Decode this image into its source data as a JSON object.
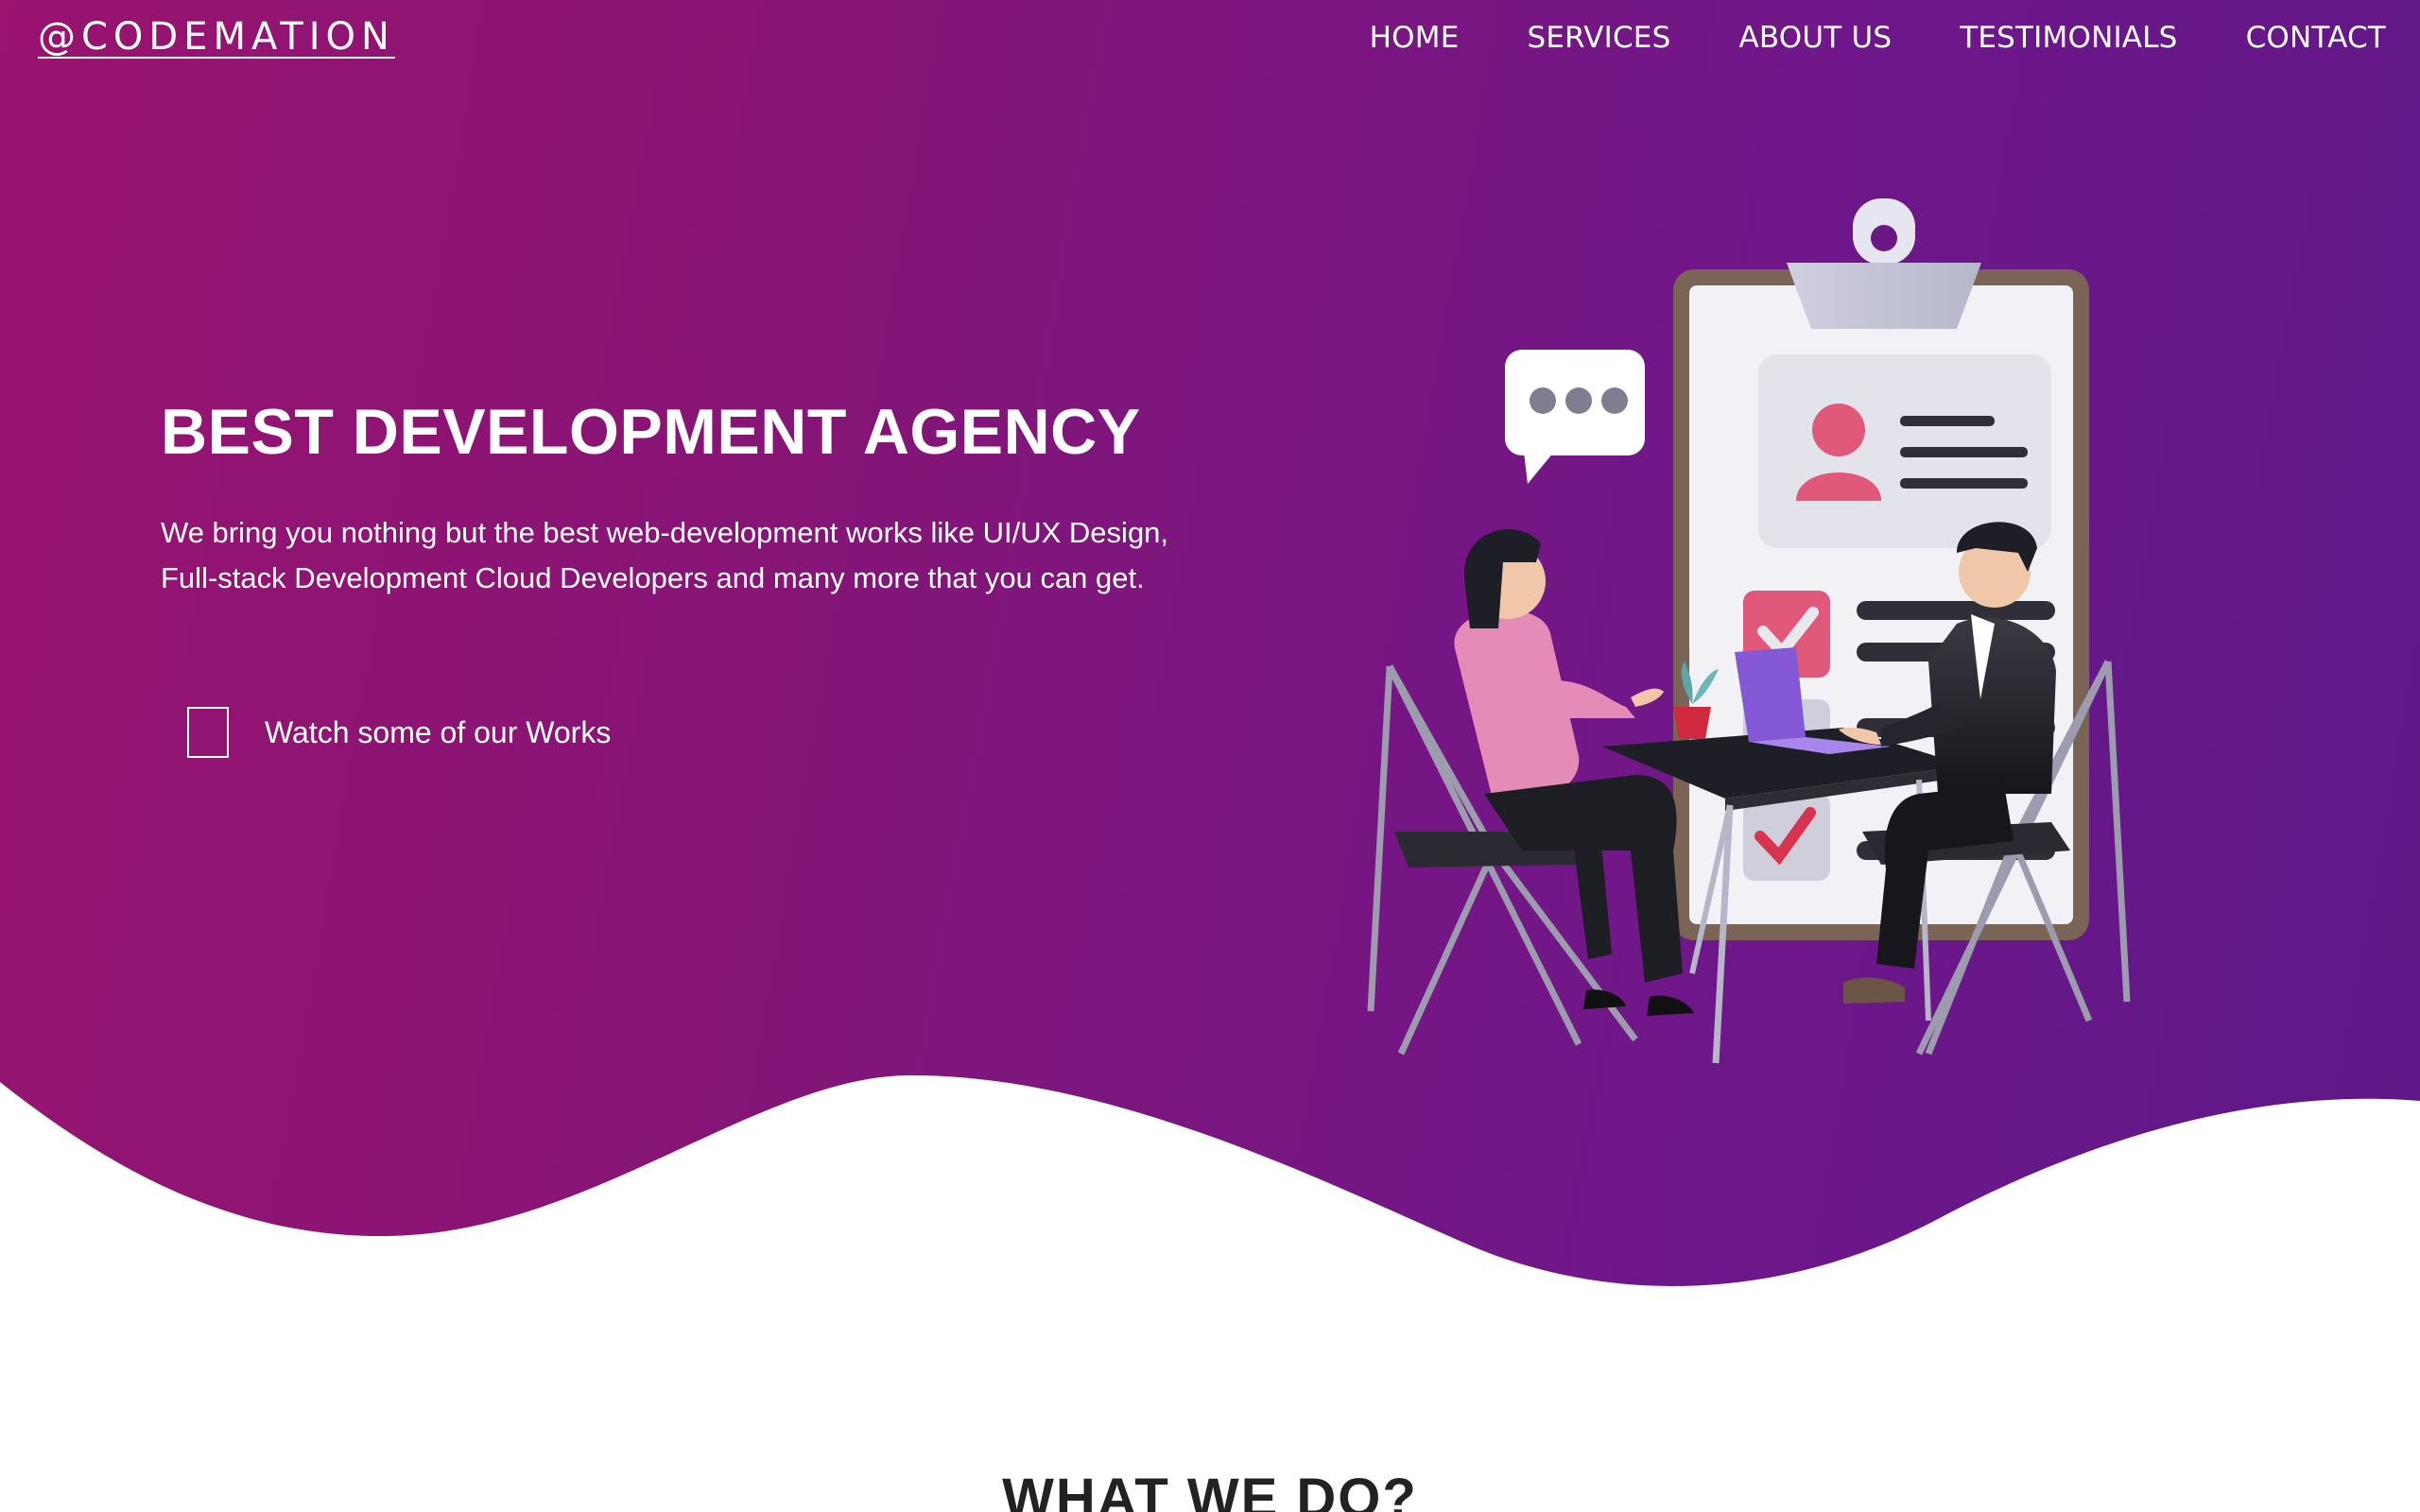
{
  "header": {
    "logo": "@CODEMATION",
    "nav": [
      {
        "label": "HOME"
      },
      {
        "label": "SERVICES"
      },
      {
        "label": "ABOUT US"
      },
      {
        "label": "TESTIMONIALS"
      },
      {
        "label": "CONTACT"
      }
    ]
  },
  "hero": {
    "title": "BEST DEVELOPMENT AGENCY",
    "description": "We bring you nothing but the best web-development works like UI/UX Design, Full-stack Development Cloud Developers and many more that you can get.",
    "cta_label": "Watch some of our Works"
  },
  "section": {
    "title": "WHAT WE DO?"
  },
  "colors": {
    "gradient_start": "#99136f",
    "gradient_end": "#5e1887",
    "text_light": "#ffffff"
  },
  "icons": [
    "chat-bubble-icon",
    "clipboard-icon",
    "user-card-icon",
    "checkmark-icon"
  ]
}
